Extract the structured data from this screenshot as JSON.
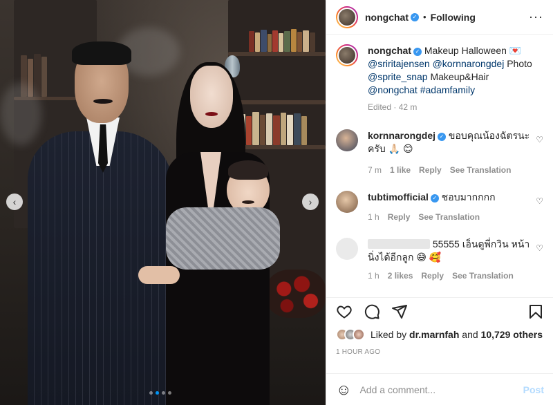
{
  "post": {
    "username": "nongchat",
    "follow_state": "Following",
    "more_icon": "more-horizontal-icon"
  },
  "caption": {
    "username": "nongchat",
    "text": "Makeup Halloween",
    "emoji": "💌",
    "mention1": "@sriritajensen",
    "mention2": "@kornnarongdej",
    "photo_label": "Photo",
    "mention3": "@sprite_snap",
    "makeup_label": "Makeup&Hair",
    "mention4": "@nongchat",
    "hashtag": "#adamfamily",
    "edited": "Edited · 42 m"
  },
  "comments": [
    {
      "username": "kornnarongdej",
      "text": "ขอบคุณน้องฉัตรนะครับ 🙏🏻 😊",
      "time": "7 m",
      "likes": "1 like",
      "reply": "Reply",
      "translate": "See Translation"
    },
    {
      "username": "tubtimofficial",
      "text": "ชอบมากกกก",
      "time": "1 h",
      "reply": "Reply",
      "translate": "See Translation"
    },
    {
      "username": "",
      "text": "55555 เอ็นดูพี่กวิน หน้านิ่งได้อีกลูก 😅 🥰",
      "time": "1 h",
      "likes": "2 likes",
      "reply": "Reply",
      "translate": "See Translation"
    }
  ],
  "likes": {
    "prefix": "Liked by",
    "user": "dr.marnfah",
    "and": "and",
    "count": "10,729 others"
  },
  "timestamp": "1 HOUR AGO",
  "composer": {
    "placeholder": "Add a comment...",
    "post_label": "Post"
  },
  "carousel": {
    "current": 2,
    "total": 4
  },
  "colors": {
    "accent": "#0095f6",
    "link": "#00376b",
    "verified": "#3897f0",
    "post_disabled": "#b3dbff"
  }
}
